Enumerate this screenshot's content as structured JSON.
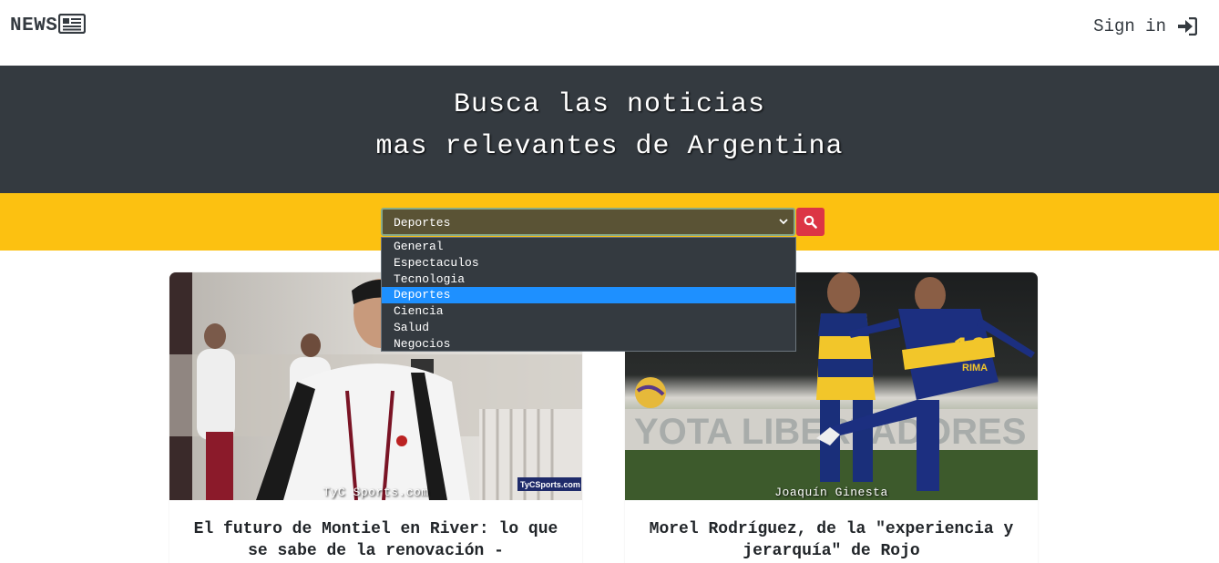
{
  "navbar": {
    "brand": "NEWS",
    "brand_icon": "newspaper-icon",
    "signin_label": "Sign in",
    "signin_icon": "sign-in-icon"
  },
  "hero": {
    "line1": "Busca las noticias",
    "line2": "mas relevantes de Argentina"
  },
  "search": {
    "selected": "Deportes",
    "options": [
      "General",
      "Espectaculos",
      "Tecnologia",
      "Deportes",
      "Ciencia",
      "Salud",
      "Negocios"
    ],
    "button_icon": "search-icon"
  },
  "cards": [
    {
      "credit": "TyC Sports.com",
      "title": "El futuro de Montiel en River: lo que se sabe de la renovación -",
      "watermark": "TyCSports.com"
    },
    {
      "credit": "Joaquín Ginesta",
      "title": "Morel Rodríguez, de la \"experiencia y jerarquía\" de Rojo",
      "sign_text": "YOTA LIBERTADORES",
      "shirt_number": "10",
      "shirt_name": "RIMA"
    }
  ],
  "colors": {
    "nav_bg": "#ffffff",
    "hero_bg": "#343a40",
    "search_bg": "#fcc111",
    "search_btn": "#dc3545",
    "dropdown_bg": "#343a40",
    "option_selected": "#1e90ff"
  }
}
